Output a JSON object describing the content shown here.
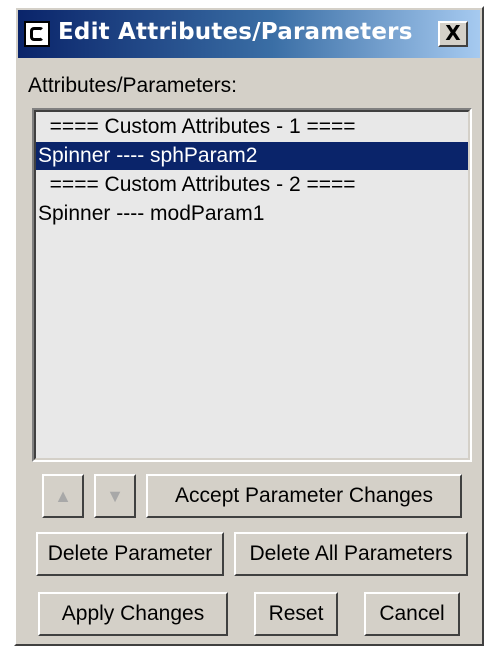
{
  "window": {
    "title": "Edit Attributes/Parameters",
    "close_label": "X"
  },
  "list": {
    "label": "Attributes/Parameters:",
    "items": [
      "  ==== Custom Attributes - 1 ====",
      "Spinner ---- sphParam2",
      "  ==== Custom Attributes - 2 ====",
      "Spinner ---- modParam1"
    ],
    "selected_index": 1
  },
  "buttons": {
    "move_up_icon": "arrow-up-icon",
    "move_down_icon": "arrow-down-icon",
    "accept": "Accept Parameter Changes",
    "delete": "Delete Parameter",
    "delete_all": "Delete All Parameters",
    "apply": "Apply Changes",
    "reset": "Reset",
    "cancel": "Cancel"
  },
  "colors": {
    "title_gradient_start": "#0a246a",
    "selection": "#0a246a",
    "face": "#d4d0c8"
  }
}
